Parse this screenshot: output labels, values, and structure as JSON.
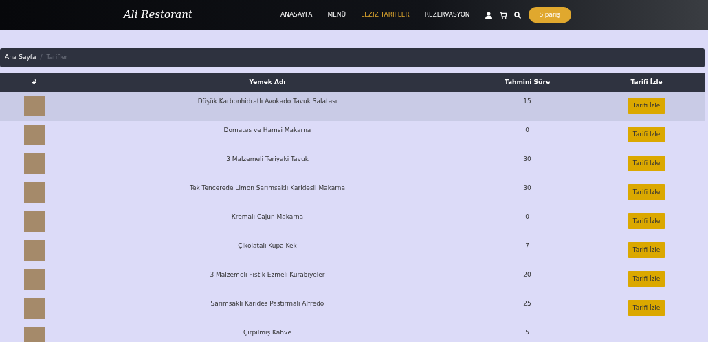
{
  "navbar": {
    "brand": "Ali Restorant",
    "links": [
      {
        "label": "ANASAYFA",
        "selected": false
      },
      {
        "label": "MENÜ",
        "selected": false
      },
      {
        "label": "LEZIZ TARIFLER",
        "selected": true
      },
      {
        "label": "REZERVASYON",
        "selected": false
      }
    ],
    "order_button": "Sipariş"
  },
  "breadcrumb": [
    {
      "label": "Ana Sayfa",
      "selected": false
    },
    {
      "separator": "/",
      "label": "Tarifler",
      "selected": true
    }
  ],
  "table": {
    "columns": [
      "#",
      "Yemek Adı",
      "Tahmini Süre",
      "Tarifi İzle"
    ],
    "rows": [
      {
        "name": "Düşük Karbonhidratlı Avokado Tavuk Salatası",
        "time": "15",
        "button": "Tarifi İzle",
        "selected": true
      },
      {
        "name": "Domates ve Hamsi Makarna",
        "time": "0",
        "button": "Tarifi İzle",
        "selected": false
      },
      {
        "name": "3 Malzemeli Teriyaki Tavuk",
        "time": "30",
        "button": "Tarifi İzle",
        "selected": false
      },
      {
        "name": "Tek Tencerede Limon Sarımsaklı Karidesli Makarna",
        "time": "30",
        "button": "Tarifi İzle",
        "selected": false
      },
      {
        "name": "Kremalı Cajun Makarna",
        "time": "0",
        "button": "Tarifi İzle",
        "selected": false
      },
      {
        "name": "Çikolatalı Kupa Kek",
        "time": "7",
        "button": "Tarifi İzle",
        "selected": false
      },
      {
        "name": "3 Malzemeli Fıstık Ezmeli Kurabiyeler",
        "time": "20",
        "button": "Tarifi İzle",
        "selected": false
      },
      {
        "name": "Sarımsaklı Karides Pastırmalı Alfredo",
        "time": "25",
        "button": "Tarifi İzle",
        "selected": false
      },
      {
        "name": "Çırpılmış Kahve",
        "time": "5",
        "selected": false
      }
    ]
  }
}
